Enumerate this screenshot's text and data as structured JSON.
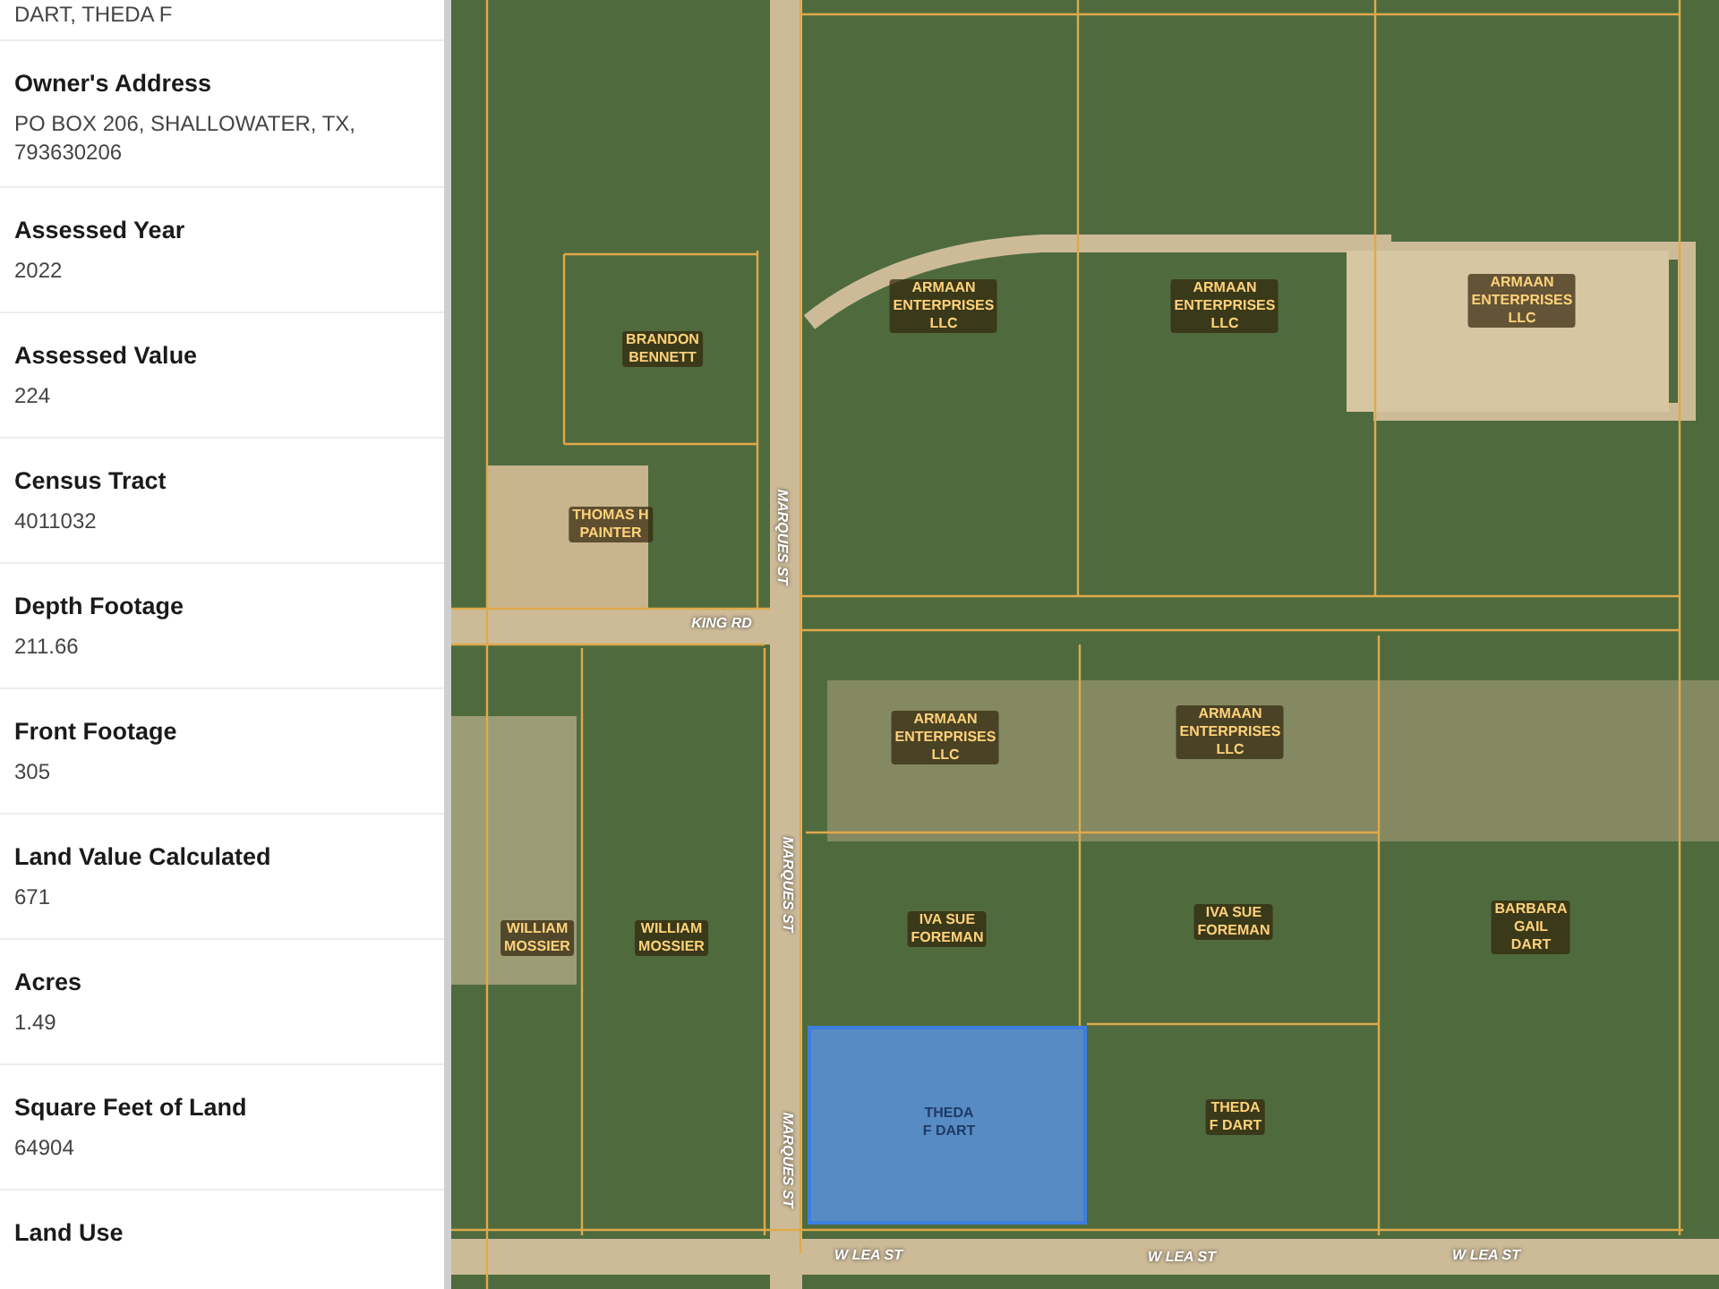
{
  "sidebar": {
    "owner_name": "DART, THEDA F",
    "fields": [
      {
        "label": "Owner's Address",
        "value": "PO BOX 206, SHALLOWATER, TX, 793630206"
      },
      {
        "label": "Assessed Year",
        "value": "2022"
      },
      {
        "label": "Assessed Value",
        "value": "224"
      },
      {
        "label": "Census Tract",
        "value": "4011032"
      },
      {
        "label": "Depth Footage",
        "value": "211.66"
      },
      {
        "label": "Front Footage",
        "value": "305"
      },
      {
        "label": "Land Value Calculated",
        "value": "671"
      },
      {
        "label": "Acres",
        "value": "1.49"
      },
      {
        "label": "Square Feet of Land",
        "value": "64904"
      },
      {
        "label": "Land Use"
      }
    ]
  },
  "map": {
    "parcels": [
      {
        "label": "BRANDON\nBENNETT",
        "selected": false
      },
      {
        "label": "THOMAS H\nPAINTER",
        "selected": false
      },
      {
        "label": "ARMAAN\nENTERPRISES\nLLC",
        "selected": false
      },
      {
        "label": "ARMAAN\nENTERPRISES\nLLC",
        "selected": false
      },
      {
        "label": "ARMAAN\nENTERPRISES\nLLC",
        "selected": false
      },
      {
        "label": "ARMAAN\nENTERPRISES\nLLC",
        "selected": false
      },
      {
        "label": "ARMAAN\nENTERPRISES\nLLC",
        "selected": false
      },
      {
        "label": "WILLIAM\nMOSSIER",
        "selected": false
      },
      {
        "label": "WILLIAM\nMOSSIER",
        "selected": false
      },
      {
        "label": "IVA SUE\nFOREMAN",
        "selected": false
      },
      {
        "label": "IVA SUE\nFOREMAN",
        "selected": false
      },
      {
        "label": "BARBARA\nGAIL\nDART",
        "selected": false
      },
      {
        "label": "THEDA\nF DART",
        "selected": true
      },
      {
        "label": "THEDA\nF DART",
        "selected": false
      }
    ],
    "streets": [
      {
        "name": "MARQUES ST",
        "kind": "vertical"
      },
      {
        "name": "KING RD",
        "kind": "horizontal"
      },
      {
        "name": "MARQUES ST",
        "kind": "vertical"
      },
      {
        "name": "MARQUES ST",
        "kind": "vertical"
      },
      {
        "name": "W LEA ST",
        "kind": "horizontal"
      },
      {
        "name": "W LEA ST",
        "kind": "horizontal"
      },
      {
        "name": "W LEA ST",
        "kind": "horizontal"
      }
    ]
  }
}
